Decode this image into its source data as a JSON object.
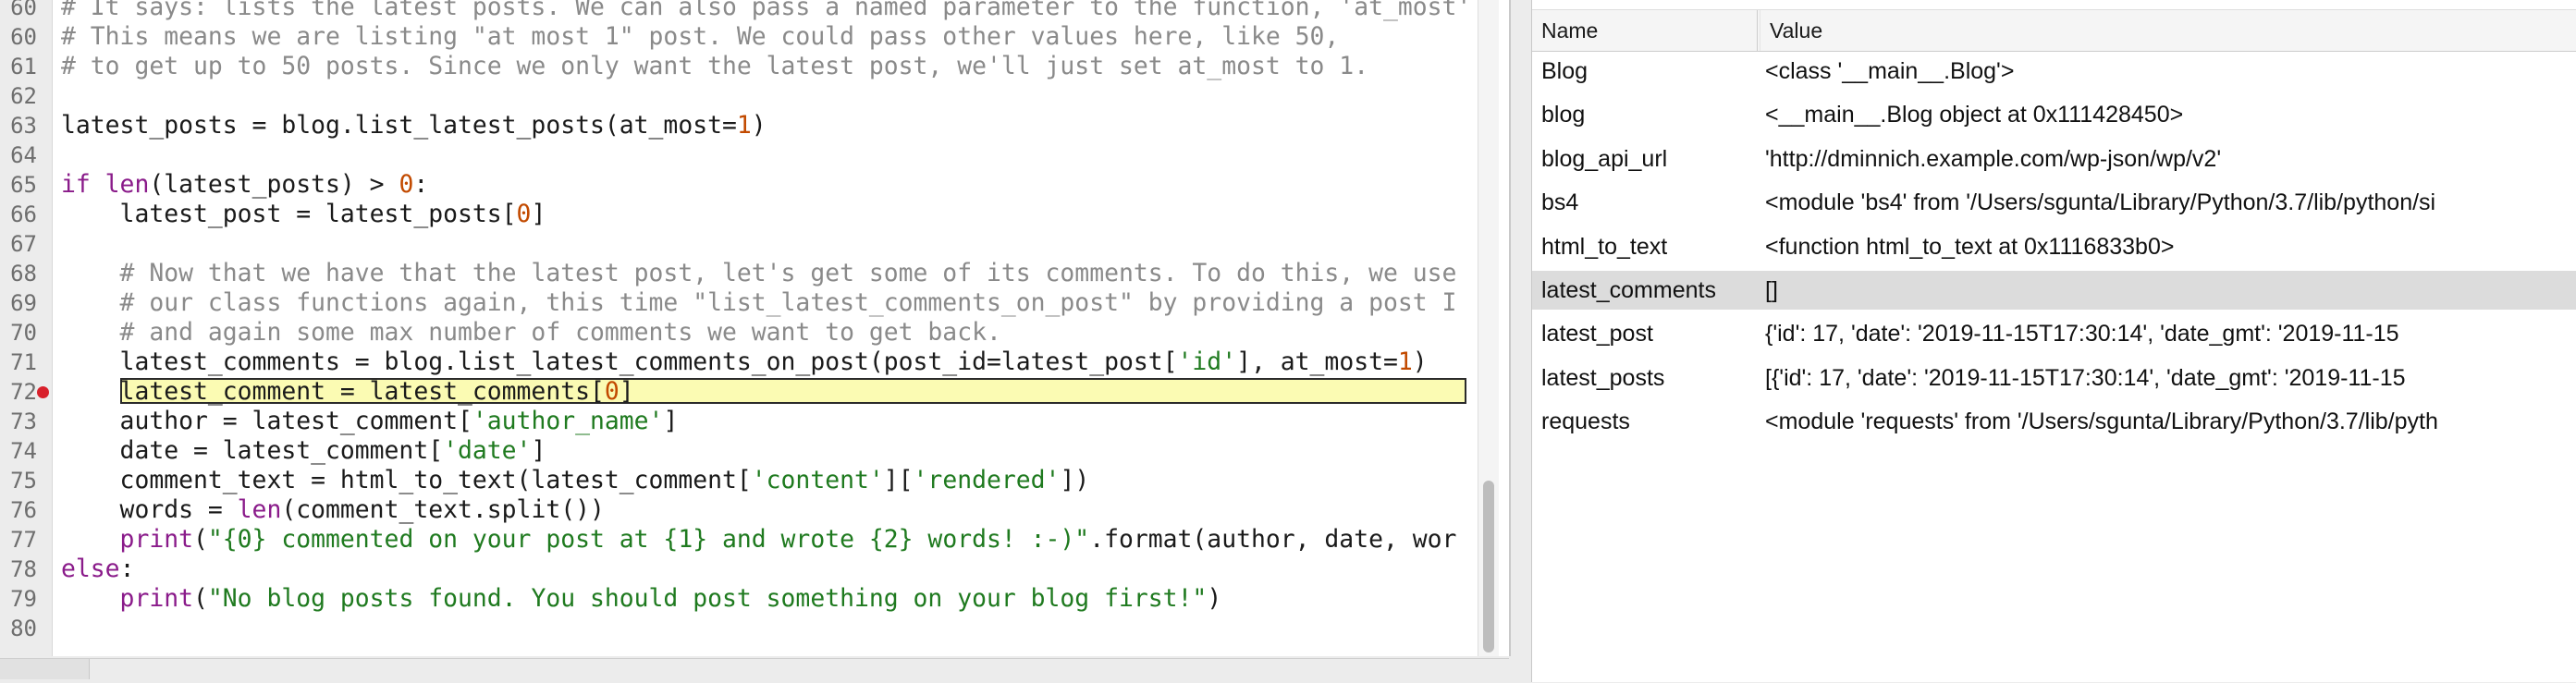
{
  "editor": {
    "breakpoint_line": "72",
    "lines": [
      {
        "num": "60",
        "tokens": [
          {
            "c": "cm",
            "t": "# It says: lists the latest posts. We can also pass a named parameter to the function, 'at_most'"
          }
        ]
      },
      {
        "num": "60",
        "tokens": [
          {
            "c": "cm",
            "t": "# This means we are listing \"at most 1\" post. We could pass other values here, like 50,"
          }
        ]
      },
      {
        "num": "61",
        "tokens": [
          {
            "c": "cm",
            "t": "# to get up to 50 posts. Since we only want the latest post, we'll just set at_most to 1."
          }
        ]
      },
      {
        "num": "62",
        "tokens": []
      },
      {
        "num": "63",
        "tokens": [
          {
            "c": "tx",
            "t": "latest_posts = blog.list_latest_posts(at_most="
          },
          {
            "c": "num",
            "t": "1"
          },
          {
            "c": "tx",
            "t": ")"
          }
        ]
      },
      {
        "num": "64",
        "tokens": []
      },
      {
        "num": "65",
        "tokens": [
          {
            "c": "kw",
            "t": "if "
          },
          {
            "c": "bi",
            "t": "len"
          },
          {
            "c": "tx",
            "t": "(latest_posts) > "
          },
          {
            "c": "num",
            "t": "0"
          },
          {
            "c": "tx",
            "t": ":"
          }
        ]
      },
      {
        "num": "66",
        "tokens": [
          {
            "c": "tx",
            "t": "    latest_post = latest_posts["
          },
          {
            "c": "num",
            "t": "0"
          },
          {
            "c": "tx",
            "t": "]"
          }
        ]
      },
      {
        "num": "67",
        "tokens": []
      },
      {
        "num": "68",
        "tokens": [
          {
            "c": "cm",
            "t": "    # Now that we have that the latest post, let's get some of its comments. To do this, we use"
          }
        ]
      },
      {
        "num": "69",
        "tokens": [
          {
            "c": "cm",
            "t": "    # our class functions again, this time \"list_latest_comments_on_post\" by providing a post I"
          }
        ]
      },
      {
        "num": "70",
        "tokens": [
          {
            "c": "cm",
            "t": "    # and again some max number of comments we want to get back."
          }
        ]
      },
      {
        "num": "71",
        "tokens": [
          {
            "c": "tx",
            "t": "    latest_comments = blog.list_latest_comments_on_post(post_id=latest_post["
          },
          {
            "c": "str",
            "t": "'id'"
          },
          {
            "c": "tx",
            "t": "], at_most="
          },
          {
            "c": "num",
            "t": "1"
          },
          {
            "c": "tx",
            "t": ")"
          }
        ]
      },
      {
        "num": "72",
        "tokens": [
          {
            "c": "tx",
            "t": "    latest_comment = latest_comments["
          },
          {
            "c": "num",
            "t": "0"
          },
          {
            "c": "tx",
            "t": "]"
          }
        ],
        "current": true
      },
      {
        "num": "73",
        "tokens": [
          {
            "c": "tx",
            "t": "    author = latest_comment["
          },
          {
            "c": "str",
            "t": "'author_name'"
          },
          {
            "c": "tx",
            "t": "]"
          }
        ]
      },
      {
        "num": "74",
        "tokens": [
          {
            "c": "tx",
            "t": "    date = latest_comment["
          },
          {
            "c": "str",
            "t": "'date'"
          },
          {
            "c": "tx",
            "t": "]"
          }
        ]
      },
      {
        "num": "75",
        "tokens": [
          {
            "c": "tx",
            "t": "    comment_text = html_to_text(latest_comment["
          },
          {
            "c": "str",
            "t": "'content'"
          },
          {
            "c": "tx",
            "t": "]["
          },
          {
            "c": "str",
            "t": "'rendered'"
          },
          {
            "c": "tx",
            "t": "])"
          }
        ]
      },
      {
        "num": "76",
        "tokens": [
          {
            "c": "tx",
            "t": "    words = "
          },
          {
            "c": "bi",
            "t": "len"
          },
          {
            "c": "tx",
            "t": "(comment_text.split())"
          }
        ]
      },
      {
        "num": "77",
        "tokens": [
          {
            "c": "bi",
            "t": "    print"
          },
          {
            "c": "tx",
            "t": "("
          },
          {
            "c": "str",
            "t": "\"{0} commented on your post at {1} and wrote {2} words! :-)\""
          },
          {
            "c": "tx",
            "t": ".format(author, date, wor"
          }
        ]
      },
      {
        "num": "78",
        "tokens": [
          {
            "c": "kw",
            "t": "else"
          },
          {
            "c": "tx",
            "t": ":"
          }
        ]
      },
      {
        "num": "79",
        "tokens": [
          {
            "c": "bi",
            "t": "    print"
          },
          {
            "c": "tx",
            "t": "("
          },
          {
            "c": "str",
            "t": "\"No blog posts found. You should post something on your blog first!\""
          },
          {
            "c": "tx",
            "t": ")"
          }
        ]
      },
      {
        "num": "80",
        "tokens": []
      }
    ]
  },
  "variables": {
    "headers": {
      "name": "Name",
      "value": "Value"
    },
    "selected_index": 5,
    "rows": [
      {
        "name": "Blog",
        "value": "<class '__main__.Blog'>"
      },
      {
        "name": "blog",
        "value": "<__main__.Blog object at 0x111428450>"
      },
      {
        "name": "blog_api_url",
        "value": "'http://dminnich.example.com/wp-json/wp/v2'"
      },
      {
        "name": "bs4",
        "value": "<module 'bs4' from '/Users/sgunta/Library/Python/3.7/lib/python/si"
      },
      {
        "name": "html_to_text",
        "value": "<function html_to_text at 0x1116833b0>"
      },
      {
        "name": "latest_comments",
        "value": "[]"
      },
      {
        "name": "latest_post",
        "value": "{'id': 17, 'date': '2019-11-15T17:30:14', 'date_gmt': '2019-11-15"
      },
      {
        "name": "latest_posts",
        "value": "[{'id': 17, 'date': '2019-11-15T17:30:14', 'date_gmt': '2019-11-15"
      },
      {
        "name": "requests",
        "value": "<module 'requests' from '/Users/sgunta/Library/Python/3.7/lib/pyth"
      }
    ]
  }
}
